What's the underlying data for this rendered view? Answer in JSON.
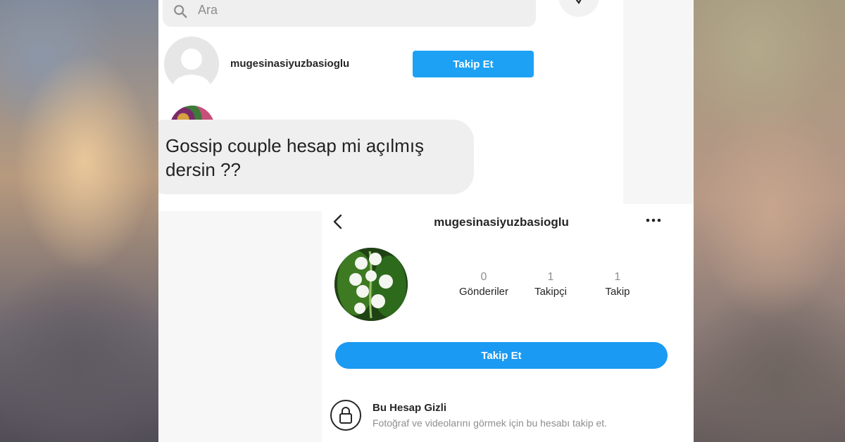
{
  "search": {
    "placeholder": "Ara"
  },
  "result": {
    "username": "mugesinasiyuzbasioglu",
    "follow_label": "Takip Et"
  },
  "message": {
    "text": "Gossip couple hesap mi açılmış dersin ??"
  },
  "profile": {
    "username": "mugesinasiyuzbasioglu",
    "stats": [
      {
        "value": "0",
        "label": "Gönderiler"
      },
      {
        "value": "1",
        "label": "Takipçi"
      },
      {
        "value": "1",
        "label": "Takip"
      }
    ],
    "follow_label": "Takip Et",
    "private_title": "Bu Hesap Gizli",
    "private_desc": "Fotoğraf ve videolarını görmek için bu hesabı takip et."
  },
  "colors": {
    "accent": "#1da1f5",
    "bubble": "#efefef",
    "text": "#262626",
    "muted": "#8e8e8e"
  },
  "icons": [
    "search-icon",
    "check-icon",
    "avatar-placeholder-icon",
    "back-icon",
    "more-icon",
    "lock-icon"
  ]
}
